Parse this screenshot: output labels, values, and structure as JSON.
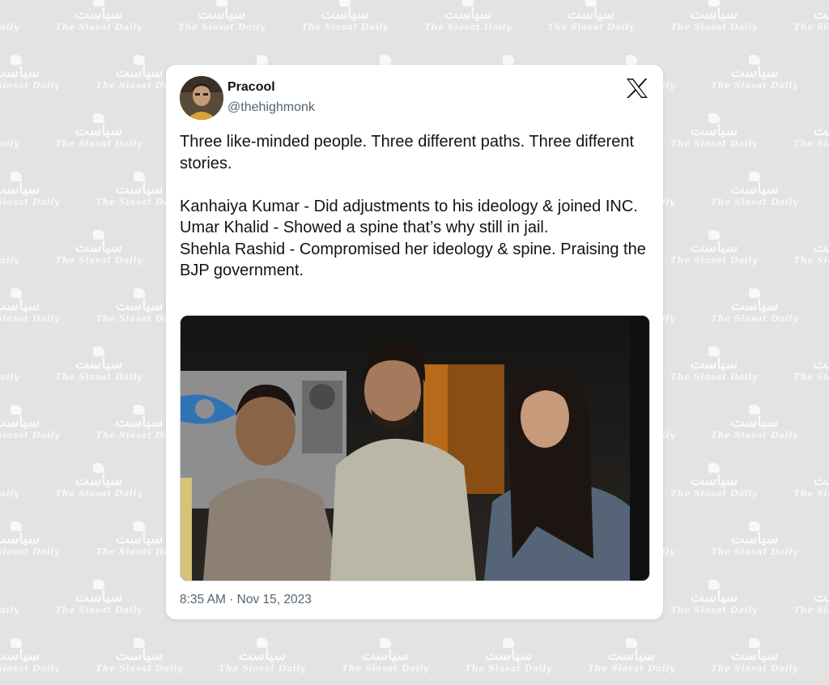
{
  "watermark": {
    "urdu": "سیاست",
    "english": "The Siasat Daily"
  },
  "tweet": {
    "author_name": "Pracool",
    "author_handle": "@thehighmonk",
    "platform_icon": "x-logo-icon",
    "text": "Three like-minded people. Three different paths. Three different stories.\n\nKanhaiya Kumar - Did adjustments to his ideology & joined INC.\nUmar Khalid - Showed a spine that’s why still in jail.\nShehla Rashid - Compromised her ideology & spine. Praising the BJP government.",
    "timestamp": "8:35 AM · Nov 15, 2023"
  },
  "colors": {
    "background": "#e3e3e3",
    "card": "#ffffff",
    "text_primary": "#0f1419",
    "text_secondary": "#536471"
  }
}
